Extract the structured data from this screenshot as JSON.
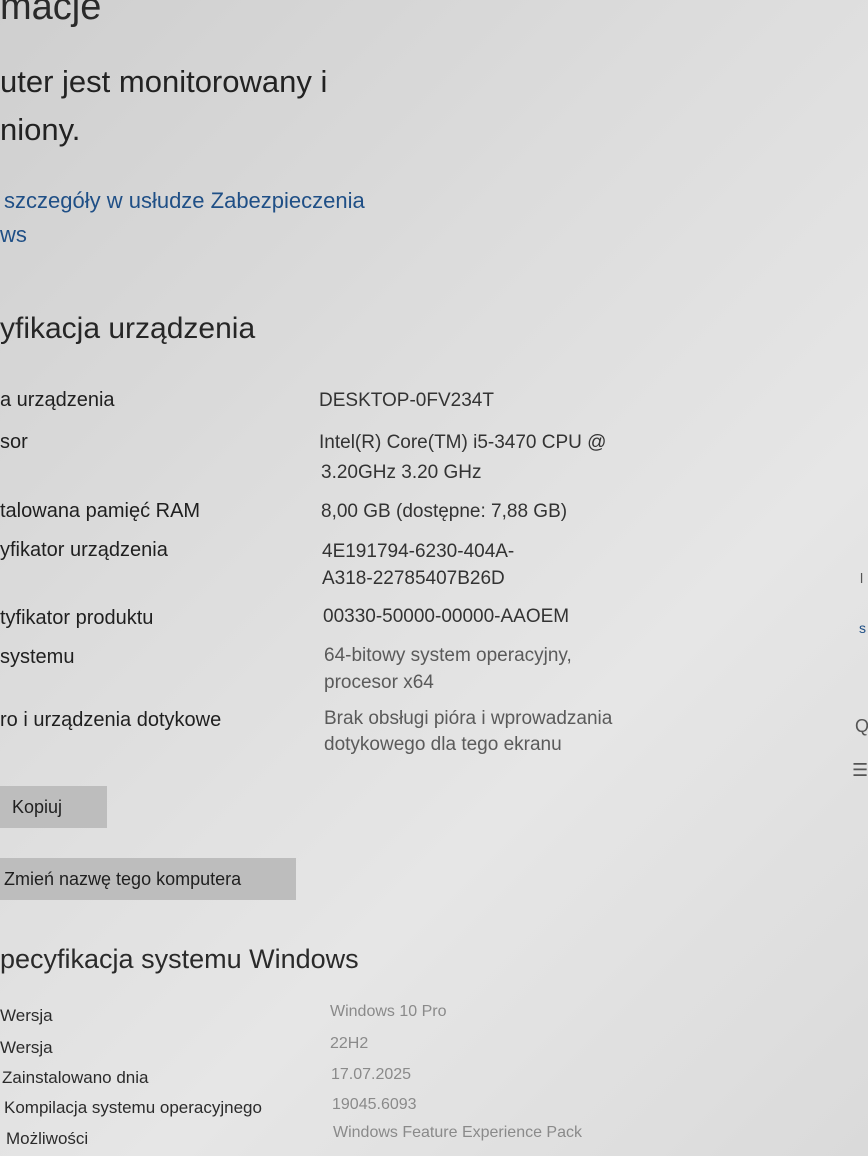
{
  "header": {
    "title_fragment": "macje",
    "status_line1": "uter jest monitorowany i",
    "status_line2": "niony.",
    "details_link_line1": "szczegóły w usłudze Zabezpieczenia",
    "details_link_line2": "ws"
  },
  "device_spec": {
    "title": "yfikacja urządzenia",
    "rows": [
      {
        "label": "a urządzenia",
        "value_line1": "DESKTOP-0FV234T",
        "value_line2": ""
      },
      {
        "label": "sor",
        "value_line1": "Intel(R) Core(TM) i5-3470 CPU @",
        "value_line2": "3.20GHz   3.20 GHz"
      },
      {
        "label": "talowana pamięć RAM",
        "value_line1": "8,00 GB (dostępne: 7,88 GB)",
        "value_line2": ""
      },
      {
        "label": "yfikator urządzenia",
        "value_line1": "4E191794-6230-404A-",
        "value_line2": "A318-22785407B26D"
      },
      {
        "label": "tyfikator produktu",
        "value_line1": "00330-50000-00000-AAOEM",
        "value_line2": ""
      },
      {
        "label": "systemu",
        "value_line1": "64-bitowy system operacyjny,",
        "value_line2": "procesor x64"
      },
      {
        "label": "ro i urządzenia dotykowe",
        "value_line1": "Brak obsługi pióra i wprowadzania",
        "value_line2": "dotykowego dla tego ekranu"
      }
    ],
    "copy_button": "Kopiuj",
    "rename_button": "Zmień nazwę tego komputera"
  },
  "windows_spec": {
    "title": "pecyfikacja systemu Windows",
    "rows": [
      {
        "label": "Wersja",
        "value": "Windows 10 Pro"
      },
      {
        "label": "Wersja",
        "value": "22H2"
      },
      {
        "label": "Zainstalowano dnia",
        "value": "17.07.2025"
      },
      {
        "label": "Kompilacja systemu operacyjnego",
        "value": "19045.6093"
      },
      {
        "label": "Możliwości",
        "value": "Windows Feature Experience Pack"
      }
    ]
  },
  "right_edge": {
    "glyph1": "l",
    "glyph2": "s",
    "glyph3": "Q",
    "glyph4": "☰"
  }
}
